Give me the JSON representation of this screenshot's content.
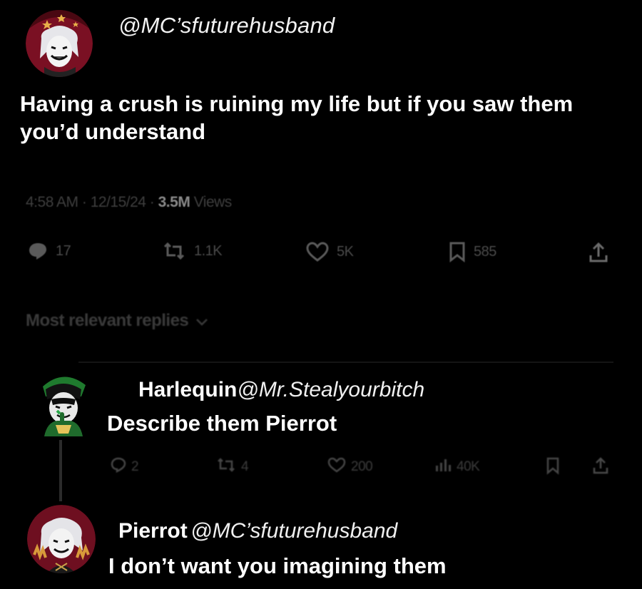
{
  "tweet": {
    "handle": "@MC’sfuturehusband",
    "text": "Having a crush is ruining my life but if you saw them you’d understand",
    "meta_time_date": "4:58 AM · 12/15/24 · ",
    "meta_views_count": "3.5M",
    "meta_views_label": " Views",
    "replies": "17",
    "retweets": "1.1K",
    "likes": "5K",
    "bookmarks": "585"
  },
  "sort_label": "Most relevant replies",
  "replies": [
    {
      "name": "Harlequin",
      "handle": "@Mr.Stealyourbitch",
      "text": "Describe them Pierrot",
      "replies": "2",
      "retweets": "4",
      "likes": "200",
      "views": "40K"
    },
    {
      "name": "Pierrot",
      "handle": "@MC’sfuturehusband",
      "text": "I don’t want you imagining them"
    }
  ],
  "colors": {
    "background": "#000000",
    "text": "#ffffff",
    "muted": "#4a4a4a",
    "avatar_pierrot": "#7a1023",
    "avatar_harlequin": "#1f6b2c"
  },
  "icons": [
    "reply-icon",
    "retweet-icon",
    "like-icon",
    "bookmark-icon",
    "share-icon",
    "views-icon",
    "chevron-down-icon"
  ]
}
